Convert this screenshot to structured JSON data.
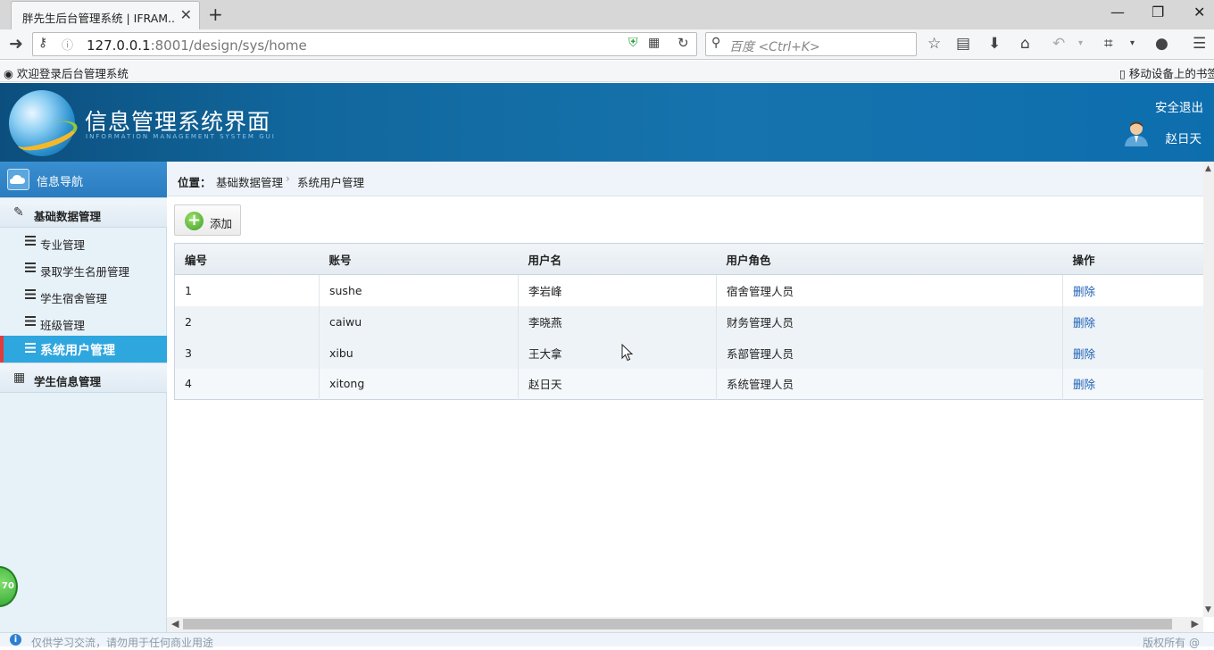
{
  "browser": {
    "tab_title": "胖先生后台管理系统 | IFRAM...",
    "url_host": "127.0.0.1",
    "url_rest": ":8001/design/sys/home",
    "search_placeholder": "百度 <Ctrl+K>",
    "bookmark_left": "欢迎登录后台管理系统",
    "bookmark_right": "移动设备上的书签"
  },
  "header": {
    "title": "信息管理系统界面",
    "subtitle": "INFORMATION MANAGEMENT SYSTEM GUI",
    "logout": "安全退出",
    "user_name": "赵日天"
  },
  "sidebar": {
    "title": "信息导航",
    "group1": "基础数据管理",
    "items": [
      {
        "label": "专业管理"
      },
      {
        "label": "录取学生名册管理"
      },
      {
        "label": "学生宿舍管理"
      },
      {
        "label": "班级管理"
      },
      {
        "label": "系统用户管理"
      }
    ],
    "group2": "学生信息管理",
    "badge": "70"
  },
  "breadcrumb": {
    "prefix": "位置：",
    "level1": "基础数据管理",
    "level2": "系统用户管理"
  },
  "toolbar": {
    "add_label": "添加"
  },
  "table": {
    "columns": [
      "编号",
      "账号",
      "用户名",
      "用户角色",
      "操作"
    ],
    "rows": [
      {
        "id": "1",
        "account": "sushe",
        "name": "李岩峰",
        "role": "宿舍管理人员",
        "action": "删除"
      },
      {
        "id": "2",
        "account": "caiwu",
        "name": "李晓燕",
        "role": "财务管理人员",
        "action": "删除"
      },
      {
        "id": "3",
        "account": "xibu",
        "name": "王大拿",
        "role": "系部管理人员",
        "action": "删除"
      },
      {
        "id": "4",
        "account": "xitong",
        "name": "赵日天",
        "role": "系统管理人员",
        "action": "删除"
      }
    ]
  },
  "footer": {
    "left": "仅供学习交流，请勿用于任何商业用途",
    "right": "版权所有 @"
  },
  "colors": {
    "header_blue": "#1673ad",
    "active_item": "#2ea6de",
    "active_marker": "#e23b3b",
    "link": "#1a5fb4"
  }
}
